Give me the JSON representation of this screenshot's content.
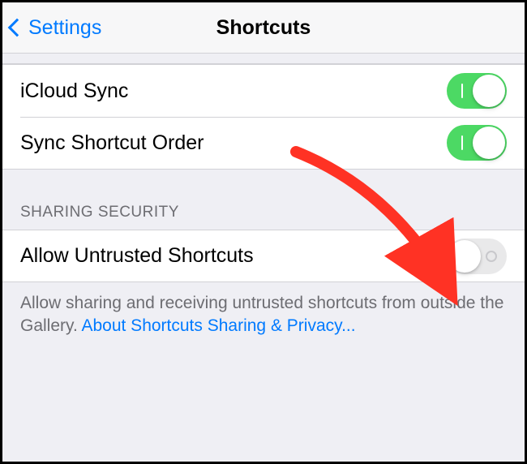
{
  "header": {
    "back_label": "Settings",
    "title": "Shortcuts"
  },
  "sync_section": {
    "icloud_sync": {
      "label": "iCloud Sync",
      "state": "on"
    },
    "sync_order": {
      "label": "Sync Shortcut Order",
      "state": "on"
    }
  },
  "sharing_section": {
    "header": "SHARING SECURITY",
    "allow_untrusted": {
      "label": "Allow Untrusted Shortcuts",
      "state": "off"
    },
    "footer_text": "Allow sharing and receiving untrusted shortcuts from outside the Gallery. ",
    "footer_link": "About Shortcuts Sharing & Privacy..."
  },
  "colors": {
    "accent": "#007aff",
    "toggle_on": "#4cd964",
    "annotation": "#ff3224"
  }
}
